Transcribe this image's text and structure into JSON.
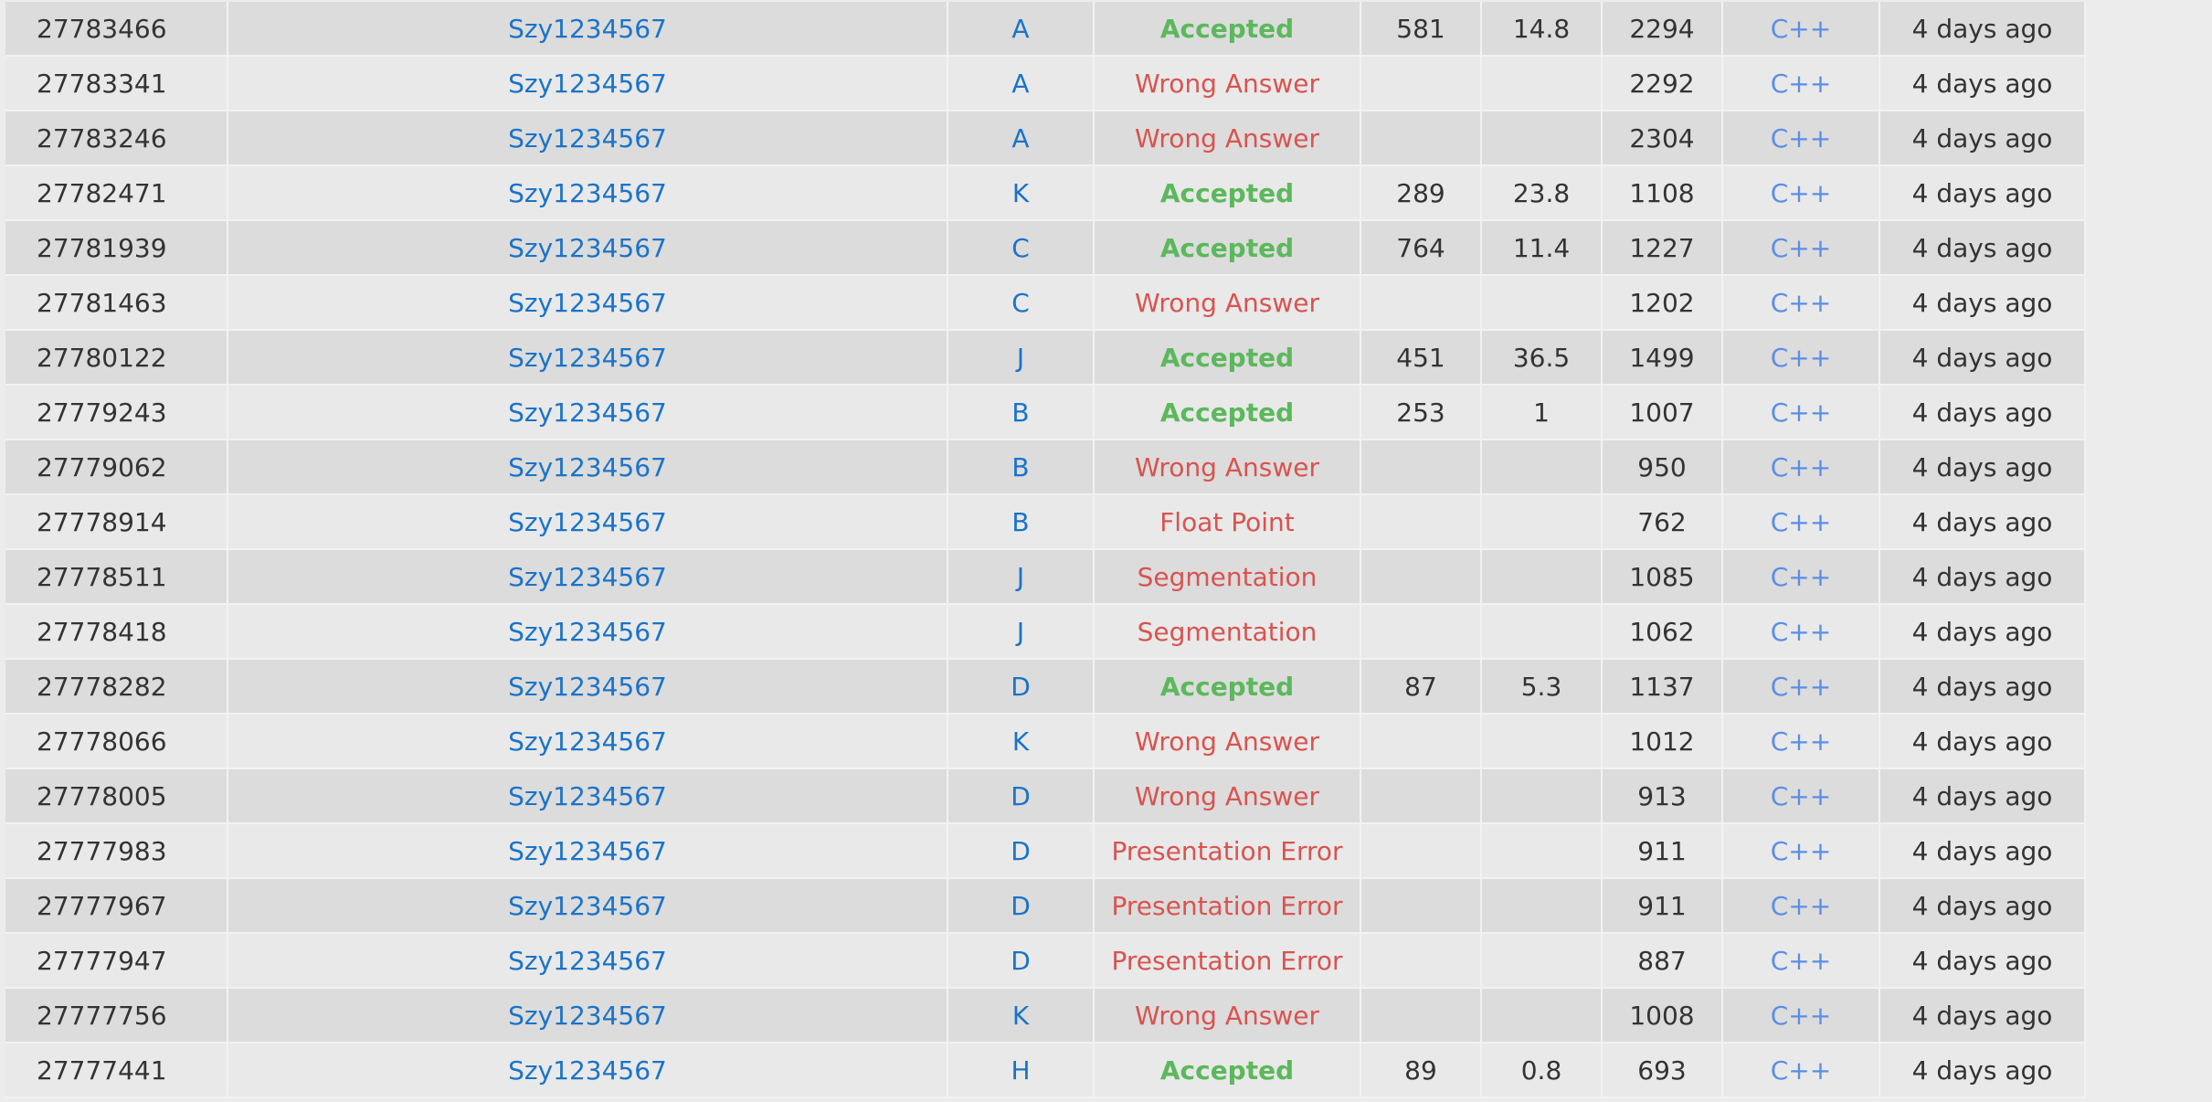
{
  "colors": {
    "accepted": "#5cb85c",
    "error": "#d9534f",
    "link": "#1a73c9",
    "language": "#5b8ee6",
    "row_odd": "#dcdcdc",
    "row_even": "#e9e9e9"
  },
  "rows": [
    {
      "id": "27783466",
      "user": "Szy1234567",
      "problem": "A",
      "result": "Accepted",
      "time": "581",
      "memory": "14.8",
      "length": "2294",
      "language": "C++",
      "submitted": "4 days ago"
    },
    {
      "id": "27783341",
      "user": "Szy1234567",
      "problem": "A",
      "result": "Wrong Answer",
      "time": "",
      "memory": "",
      "length": "2292",
      "language": "C++",
      "submitted": "4 days ago"
    },
    {
      "id": "27783246",
      "user": "Szy1234567",
      "problem": "A",
      "result": "Wrong Answer",
      "time": "",
      "memory": "",
      "length": "2304",
      "language": "C++",
      "submitted": "4 days ago"
    },
    {
      "id": "27782471",
      "user": "Szy1234567",
      "problem": "K",
      "result": "Accepted",
      "time": "289",
      "memory": "23.8",
      "length": "1108",
      "language": "C++",
      "submitted": "4 days ago"
    },
    {
      "id": "27781939",
      "user": "Szy1234567",
      "problem": "C",
      "result": "Accepted",
      "time": "764",
      "memory": "11.4",
      "length": "1227",
      "language": "C++",
      "submitted": "4 days ago"
    },
    {
      "id": "27781463",
      "user": "Szy1234567",
      "problem": "C",
      "result": "Wrong Answer",
      "time": "",
      "memory": "",
      "length": "1202",
      "language": "C++",
      "submitted": "4 days ago"
    },
    {
      "id": "27780122",
      "user": "Szy1234567",
      "problem": "J",
      "result": "Accepted",
      "time": "451",
      "memory": "36.5",
      "length": "1499",
      "language": "C++",
      "submitted": "4 days ago"
    },
    {
      "id": "27779243",
      "user": "Szy1234567",
      "problem": "B",
      "result": "Accepted",
      "time": "253",
      "memory": "1",
      "length": "1007",
      "language": "C++",
      "submitted": "4 days ago"
    },
    {
      "id": "27779062",
      "user": "Szy1234567",
      "problem": "B",
      "result": "Wrong Answer",
      "time": "",
      "memory": "",
      "length": "950",
      "language": "C++",
      "submitted": "4 days ago"
    },
    {
      "id": "27778914",
      "user": "Szy1234567",
      "problem": "B",
      "result": "Float Point",
      "time": "",
      "memory": "",
      "length": "762",
      "language": "C++",
      "submitted": "4 days ago"
    },
    {
      "id": "27778511",
      "user": "Szy1234567",
      "problem": "J",
      "result": "Segmentation",
      "time": "",
      "memory": "",
      "length": "1085",
      "language": "C++",
      "submitted": "4 days ago"
    },
    {
      "id": "27778418",
      "user": "Szy1234567",
      "problem": "J",
      "result": "Segmentation",
      "time": "",
      "memory": "",
      "length": "1062",
      "language": "C++",
      "submitted": "4 days ago"
    },
    {
      "id": "27778282",
      "user": "Szy1234567",
      "problem": "D",
      "result": "Accepted",
      "time": "87",
      "memory": "5.3",
      "length": "1137",
      "language": "C++",
      "submitted": "4 days ago"
    },
    {
      "id": "27778066",
      "user": "Szy1234567",
      "problem": "K",
      "result": "Wrong Answer",
      "time": "",
      "memory": "",
      "length": "1012",
      "language": "C++",
      "submitted": "4 days ago"
    },
    {
      "id": "27778005",
      "user": "Szy1234567",
      "problem": "D",
      "result": "Wrong Answer",
      "time": "",
      "memory": "",
      "length": "913",
      "language": "C++",
      "submitted": "4 days ago"
    },
    {
      "id": "27777983",
      "user": "Szy1234567",
      "problem": "D",
      "result": "Presentation Error",
      "time": "",
      "memory": "",
      "length": "911",
      "language": "C++",
      "submitted": "4 days ago"
    },
    {
      "id": "27777967",
      "user": "Szy1234567",
      "problem": "D",
      "result": "Presentation Error",
      "time": "",
      "memory": "",
      "length": "911",
      "language": "C++",
      "submitted": "4 days ago"
    },
    {
      "id": "27777947",
      "user": "Szy1234567",
      "problem": "D",
      "result": "Presentation Error",
      "time": "",
      "memory": "",
      "length": "887",
      "language": "C++",
      "submitted": "4 days ago"
    },
    {
      "id": "27777756",
      "user": "Szy1234567",
      "problem": "K",
      "result": "Wrong Answer",
      "time": "",
      "memory": "",
      "length": "1008",
      "language": "C++",
      "submitted": "4 days ago"
    },
    {
      "id": "27777441",
      "user": "Szy1234567",
      "problem": "H",
      "result": "Accepted",
      "time": "89",
      "memory": "0.8",
      "length": "693",
      "language": "C++",
      "submitted": "4 days ago"
    }
  ]
}
